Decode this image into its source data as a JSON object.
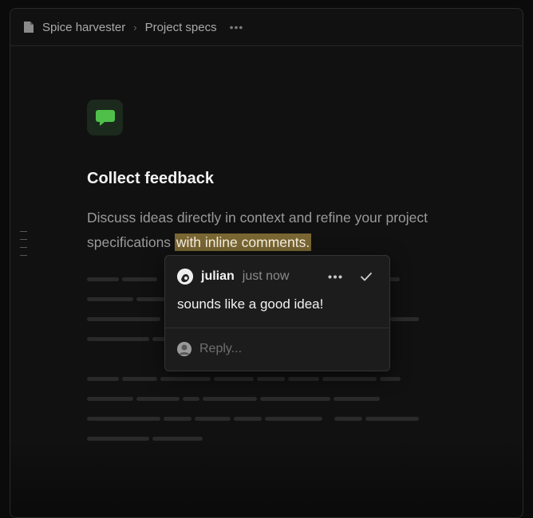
{
  "breadcrumb": {
    "workspace": "Spice harvester",
    "page": "Project specs",
    "separator": "›",
    "more": "•••"
  },
  "doc": {
    "title": "Collect feedback",
    "description_plain": "Discuss ideas directly in context and refine your project specifications ",
    "description_highlight": "with inline comments."
  },
  "comment": {
    "author": "julian",
    "time": "just now",
    "text": "sounds like a good idea!",
    "reply_placeholder": "Reply..."
  },
  "icons": {
    "doc": "document-icon",
    "app": "chat-bubble-icon",
    "more": "ellipsis-icon",
    "resolve": "check-icon"
  },
  "colors": {
    "accent": "#4fbf4a",
    "highlight": "#7a6633",
    "background": "#111111"
  }
}
